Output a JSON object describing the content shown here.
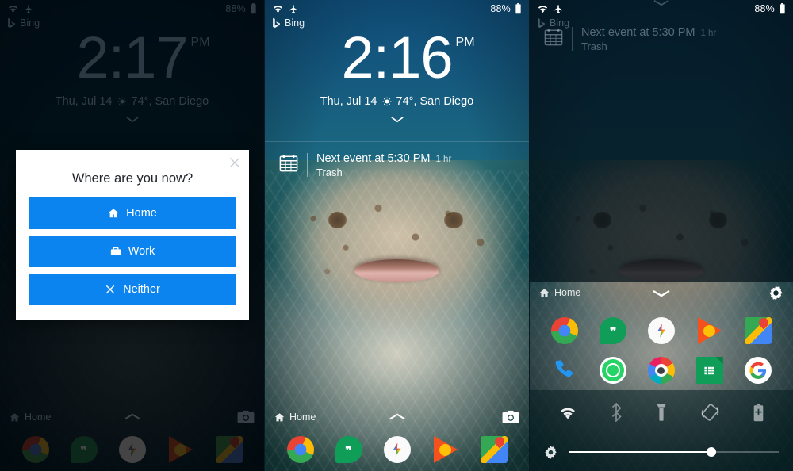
{
  "panels": [
    {
      "id": "panel-lockscreen-dialog",
      "status": {
        "battery": "88%",
        "wifi_icon": "wifi-icon",
        "airplane_icon": "airplane-mode-icon",
        "battery_icon": "battery-icon"
      },
      "bing": {
        "label": "Bing",
        "icon": "bing-icon"
      },
      "clock": {
        "time": "2:17",
        "ampm": "PM"
      },
      "date": {
        "text": "Thu, Jul 14",
        "weather_icon": "weather-sun-icon",
        "temp_location": "74°, San Diego"
      },
      "expand_icon": "chevron-down-icon",
      "home_label": "Home",
      "home_icon": "home-icon",
      "camera_icon": "camera-icon",
      "dock_chevron_icon": "chevron-up-icon",
      "dock": [
        {
          "name": "chrome-icon",
          "label": "Chrome"
        },
        {
          "name": "hangouts-icon",
          "label": "Hangouts"
        },
        {
          "name": "photos-icon",
          "label": "Photos"
        },
        {
          "name": "play-music-icon",
          "label": "Play Music"
        },
        {
          "name": "maps-icon",
          "label": "Maps"
        }
      ],
      "dialog": {
        "title": "Where are you now?",
        "close_icon": "close-icon",
        "buttons": [
          {
            "label": "Home",
            "icon": "home-icon"
          },
          {
            "label": "Work",
            "icon": "briefcase-icon"
          },
          {
            "label": "Neither",
            "icon": "x-icon"
          }
        ],
        "accent": "#0b84ef"
      }
    },
    {
      "id": "panel-lockscreen-notification",
      "status": {
        "battery": "88%",
        "wifi_icon": "wifi-icon",
        "airplane_icon": "airplane-mode-icon",
        "battery_icon": "battery-icon"
      },
      "bing": {
        "label": "Bing",
        "icon": "bing-icon"
      },
      "clock": {
        "time": "2:16",
        "ampm": "PM"
      },
      "date": {
        "text": "Thu, Jul 14",
        "weather_icon": "weather-sun-icon",
        "temp_location": "74°, San Diego"
      },
      "expand_icon": "chevron-down-icon",
      "notification": {
        "icon": "calendar-icon",
        "title": "Next event at 5:30 PM",
        "duration": "1 hr",
        "subtitle": "Trash"
      },
      "home_label": "Home",
      "home_icon": "home-icon",
      "camera_icon": "camera-icon",
      "dock_chevron_icon": "chevron-up-icon",
      "dock": [
        {
          "name": "chrome-icon",
          "label": "Chrome"
        },
        {
          "name": "hangouts-icon",
          "label": "Hangouts"
        },
        {
          "name": "photos-icon",
          "label": "Photos"
        },
        {
          "name": "play-music-icon",
          "label": "Play Music"
        },
        {
          "name": "maps-icon",
          "label": "Maps"
        }
      ]
    },
    {
      "id": "panel-quick-settings",
      "status": {
        "battery": "88%",
        "wifi_icon": "wifi-icon",
        "airplane_icon": "airplane-mode-icon",
        "battery_icon": "battery-icon"
      },
      "bing": {
        "label": "Bing",
        "icon": "bing-icon"
      },
      "notification": {
        "icon": "calendar-icon",
        "title": "Next event at 5:30 PM",
        "duration": "1 hr",
        "subtitle": "Trash"
      },
      "drawer_handle_icon": "chevron-down-icon",
      "home_label": "Home",
      "home_icon": "home-icon",
      "settings_icon": "gear-icon",
      "app_rows": [
        [
          {
            "name": "chrome-icon",
            "label": "Chrome"
          },
          {
            "name": "hangouts-icon",
            "label": "Hangouts"
          },
          {
            "name": "photos-icon",
            "label": "Photos"
          },
          {
            "name": "play-music-icon",
            "label": "Play Music"
          },
          {
            "name": "maps-icon",
            "label": "Maps"
          }
        ],
        [
          {
            "name": "phone-icon",
            "label": "Phone"
          },
          {
            "name": "whatsapp-icon",
            "label": "WhatsApp"
          },
          {
            "name": "camera-app-icon",
            "label": "Camera"
          },
          {
            "name": "sheets-icon",
            "label": "Sheets"
          },
          {
            "name": "google-icon",
            "label": "Google"
          }
        ]
      ],
      "toggles": [
        {
          "name": "wifi-toggle-icon",
          "label": "Wi-Fi",
          "on": true
        },
        {
          "name": "bluetooth-toggle-icon",
          "label": "Bluetooth",
          "on": false
        },
        {
          "name": "flashlight-toggle-icon",
          "label": "Flashlight",
          "on": false
        },
        {
          "name": "auto-rotate-toggle-icon",
          "label": "Auto-rotate",
          "on": false
        },
        {
          "name": "battery-saver-toggle-icon",
          "label": "Battery saver",
          "on": false
        }
      ],
      "brightness": {
        "icon": "brightness-gear-icon",
        "value_percent": 68
      }
    }
  ]
}
